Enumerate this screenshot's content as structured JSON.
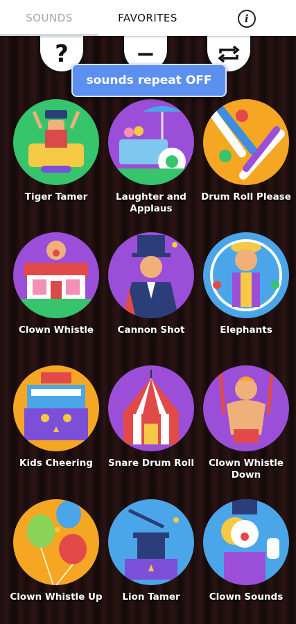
{
  "tabs": {
    "sounds": "SOUNDS",
    "favorites": "FAVORITES",
    "info_icon": "info-icon"
  },
  "toolbar": {
    "help_symbol": "?",
    "minus_symbol": "−",
    "repeat_icon": "repeat-icon"
  },
  "toast": {
    "text": "sounds repeat OFF"
  },
  "sounds": [
    {
      "label": "Tiger Tamer",
      "color": "#36c46c"
    },
    {
      "label": "Laughter and Applaus",
      "color": "#9b4fd8"
    },
    {
      "label": "Drum Roll Please",
      "color": "#f5a623"
    },
    {
      "label": "Clown Whistle",
      "color": "#9b4fd8"
    },
    {
      "label": "Cannon Shot",
      "color": "#9b4fd8"
    },
    {
      "label": "Elephants",
      "color": "#4aa6e8"
    },
    {
      "label": "Kids Cheering",
      "color": "#f5a623"
    },
    {
      "label": "Snare Drum Roll",
      "color": "#9b4fd8"
    },
    {
      "label": "Clown Whistle Down",
      "color": "#9b4fd8"
    },
    {
      "label": "Clown Whistle Up",
      "color": "#f5a623"
    },
    {
      "label": "Lion Tamer",
      "color": "#4aa6e8"
    },
    {
      "label": "Clown Sounds",
      "color": "#4aa6e8"
    }
  ]
}
